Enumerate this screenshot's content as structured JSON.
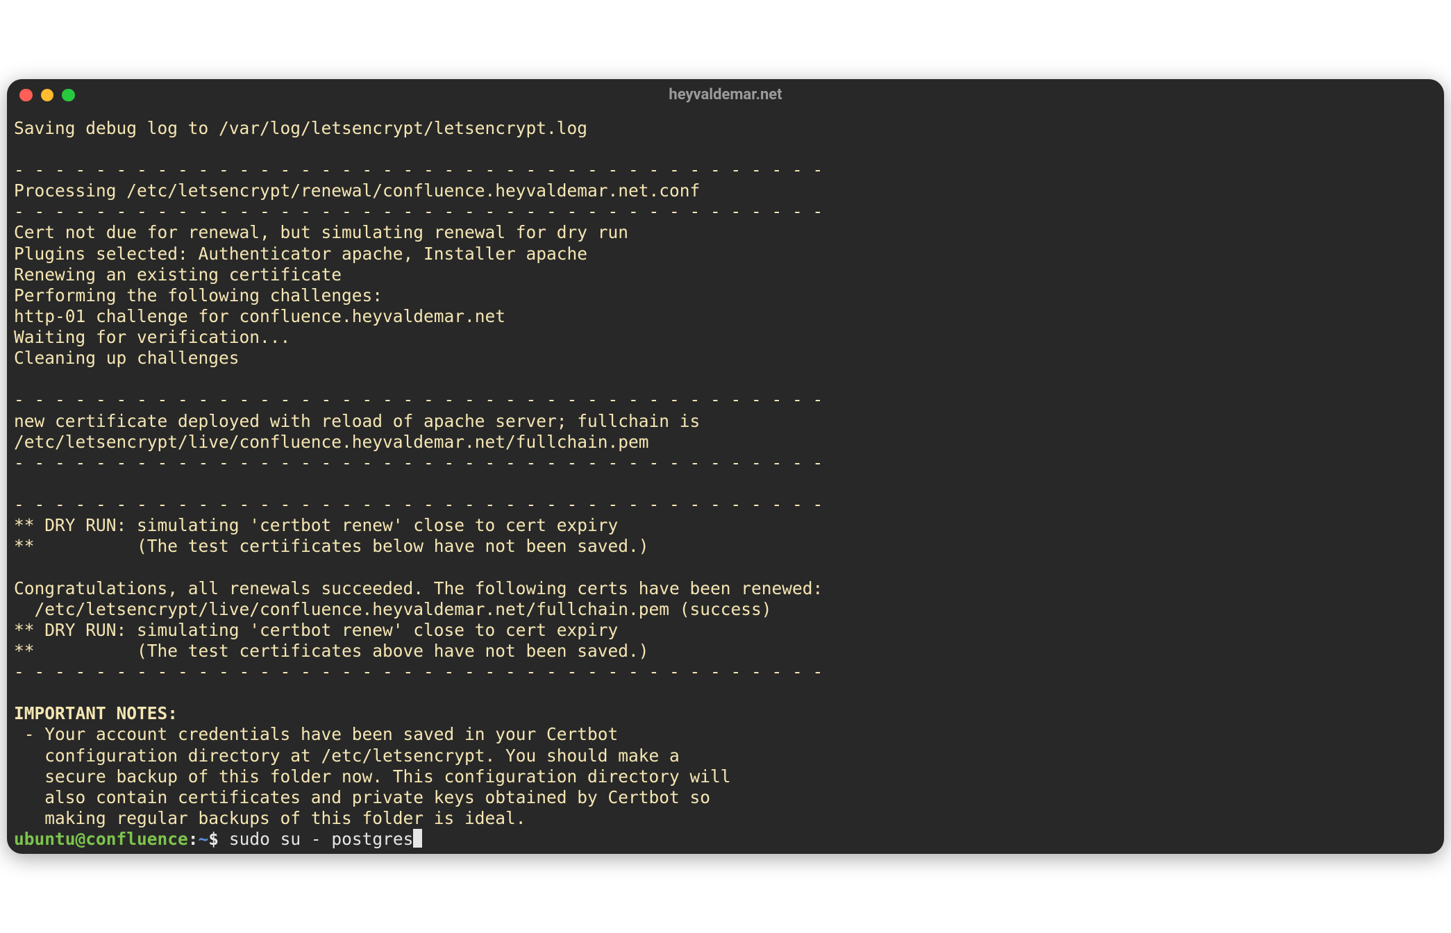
{
  "window": {
    "title": "heyvaldemar.net"
  },
  "terminal": {
    "lines": [
      {
        "text": "Saving debug log to /var/log/letsencrypt/letsencrypt.log"
      },
      {
        "text": ""
      },
      {
        "text": "- - - - - - - - - - - - - - - - - - - - - - - - - - - - - - - - - - - - - - - -"
      },
      {
        "text": "Processing /etc/letsencrypt/renewal/confluence.heyvaldemar.net.conf"
      },
      {
        "text": "- - - - - - - - - - - - - - - - - - - - - - - - - - - - - - - - - - - - - - - -"
      },
      {
        "text": "Cert not due for renewal, but simulating renewal for dry run"
      },
      {
        "text": "Plugins selected: Authenticator apache, Installer apache"
      },
      {
        "text": "Renewing an existing certificate"
      },
      {
        "text": "Performing the following challenges:"
      },
      {
        "text": "http-01 challenge for confluence.heyvaldemar.net"
      },
      {
        "text": "Waiting for verification..."
      },
      {
        "text": "Cleaning up challenges"
      },
      {
        "text": ""
      },
      {
        "text": "- - - - - - - - - - - - - - - - - - - - - - - - - - - - - - - - - - - - - - - -"
      },
      {
        "text": "new certificate deployed with reload of apache server; fullchain is"
      },
      {
        "text": "/etc/letsencrypt/live/confluence.heyvaldemar.net/fullchain.pem"
      },
      {
        "text": "- - - - - - - - - - - - - - - - - - - - - - - - - - - - - - - - - - - - - - - -"
      },
      {
        "text": ""
      },
      {
        "text": "- - - - - - - - - - - - - - - - - - - - - - - - - - - - - - - - - - - - - - - -"
      },
      {
        "text": "** DRY RUN: simulating 'certbot renew' close to cert expiry"
      },
      {
        "text": "**          (The test certificates below have not been saved.)"
      },
      {
        "text": ""
      },
      {
        "text": "Congratulations, all renewals succeeded. The following certs have been renewed:"
      },
      {
        "text": "  /etc/letsencrypt/live/confluence.heyvaldemar.net/fullchain.pem (success)"
      },
      {
        "text": "** DRY RUN: simulating 'certbot renew' close to cert expiry"
      },
      {
        "text": "**          (The test certificates above have not been saved.)"
      },
      {
        "text": "- - - - - - - - - - - - - - - - - - - - - - - - - - - - - - - - - - - - - - - -"
      },
      {
        "text": ""
      },
      {
        "text": "IMPORTANT NOTES:",
        "bold": true
      },
      {
        "text": " - Your account credentials have been saved in your Certbot"
      },
      {
        "text": "   configuration directory at /etc/letsencrypt. You should make a"
      },
      {
        "text": "   secure backup of this folder now. This configuration directory will"
      },
      {
        "text": "   also contain certificates and private keys obtained by Certbot so"
      },
      {
        "text": "   making regular backups of this folder is ideal."
      }
    ],
    "prompt": {
      "user_host": "ubuntu@confluence",
      "cwd": "~",
      "symbol": "$",
      "command": "sudo su - postgres"
    }
  }
}
